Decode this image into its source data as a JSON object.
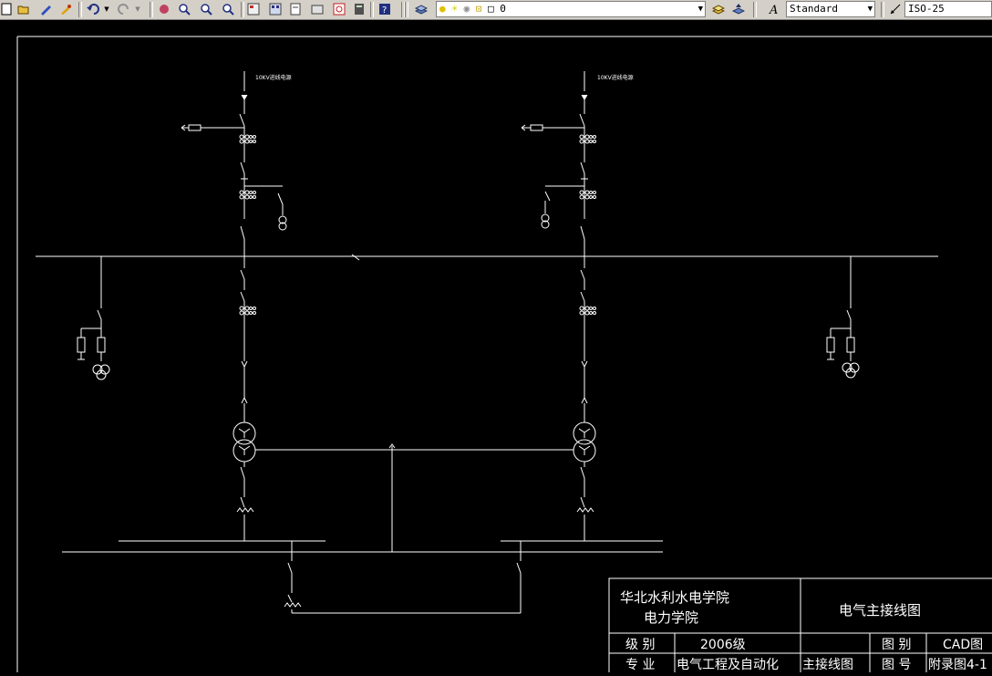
{
  "toolbar": {
    "layer_value": "0",
    "text_style_value": "Standard",
    "dim_style_value": "ISO-25"
  },
  "drawing": {
    "left_feed_label": "10KV进线电源",
    "right_feed_label": "10KV进线电源"
  },
  "title_block": {
    "school_line1": "华北水利水电学院",
    "school_line2": "电力学院",
    "drawing_title": "电气主接线图",
    "grade_label": "级 别",
    "grade_value": "2006级",
    "category_label": "图 别",
    "category_value": "CAD图",
    "major_label": "专 业",
    "major_value": "电气工程及自动化",
    "name_value": "主接线图",
    "number_label": "图 号",
    "number_value": "附录图4-1"
  },
  "colors": {
    "background": "#000000",
    "lines": "#ffffff",
    "toolbar": "#d4d0c8"
  }
}
